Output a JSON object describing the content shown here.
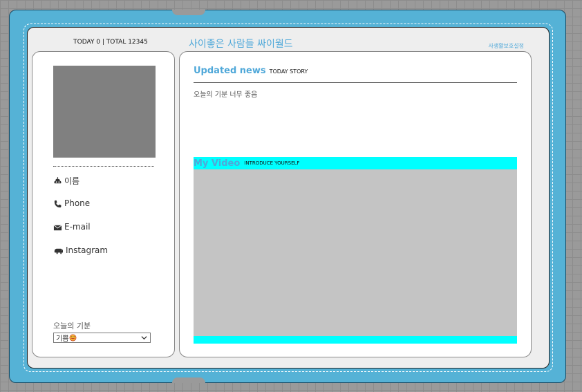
{
  "header": {
    "visit_counter": "TODAY 0 | TOTAL 12345",
    "site_title": "사이좋은 사람들 싸이월드",
    "privacy_link": "사생활보호설정"
  },
  "profile": {
    "items": [
      {
        "icon": "poop-icon",
        "label": "이름"
      },
      {
        "icon": "phone-icon",
        "label": "Phone"
      },
      {
        "icon": "envelope-icon",
        "label": "E-mail"
      },
      {
        "icon": "hippo-icon",
        "label": "Instagram"
      }
    ],
    "mood_label": "오늘의 기분",
    "mood_selected": "기쁨"
  },
  "news": {
    "title": "Updated news",
    "subtitle": "TODAY STORY",
    "body": "오늘의 기분 너무 좋음"
  },
  "video": {
    "title": "My Video",
    "subtitle": "INTRODUCE YOURSELF"
  },
  "colors": {
    "accent": "#4fa8d9",
    "book": "#55b2d6",
    "cyan_bar": "#00ffff",
    "video_placeholder": "#c4c4c4",
    "photo_placeholder": "#808080"
  }
}
